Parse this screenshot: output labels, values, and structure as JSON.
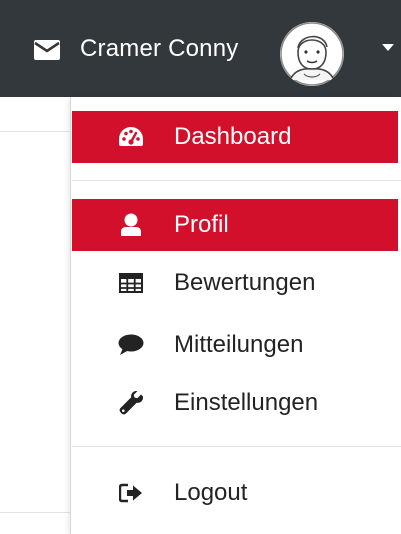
{
  "header": {
    "user_name": "Cramer Conny",
    "icons": {
      "mail": "envelope-icon",
      "avatar": "user-avatar",
      "caret": "caret-down-icon"
    }
  },
  "menu": {
    "dashboard": "Dashboard",
    "profil": "Profil",
    "bewertungen": "Bewertungen",
    "mitteilungen": "Mitteilungen",
    "einstellungen": "Einstellungen",
    "logout": "Logout"
  },
  "colors": {
    "topbar": "#33383c",
    "active": "#d3102b",
    "text": "#232323"
  }
}
